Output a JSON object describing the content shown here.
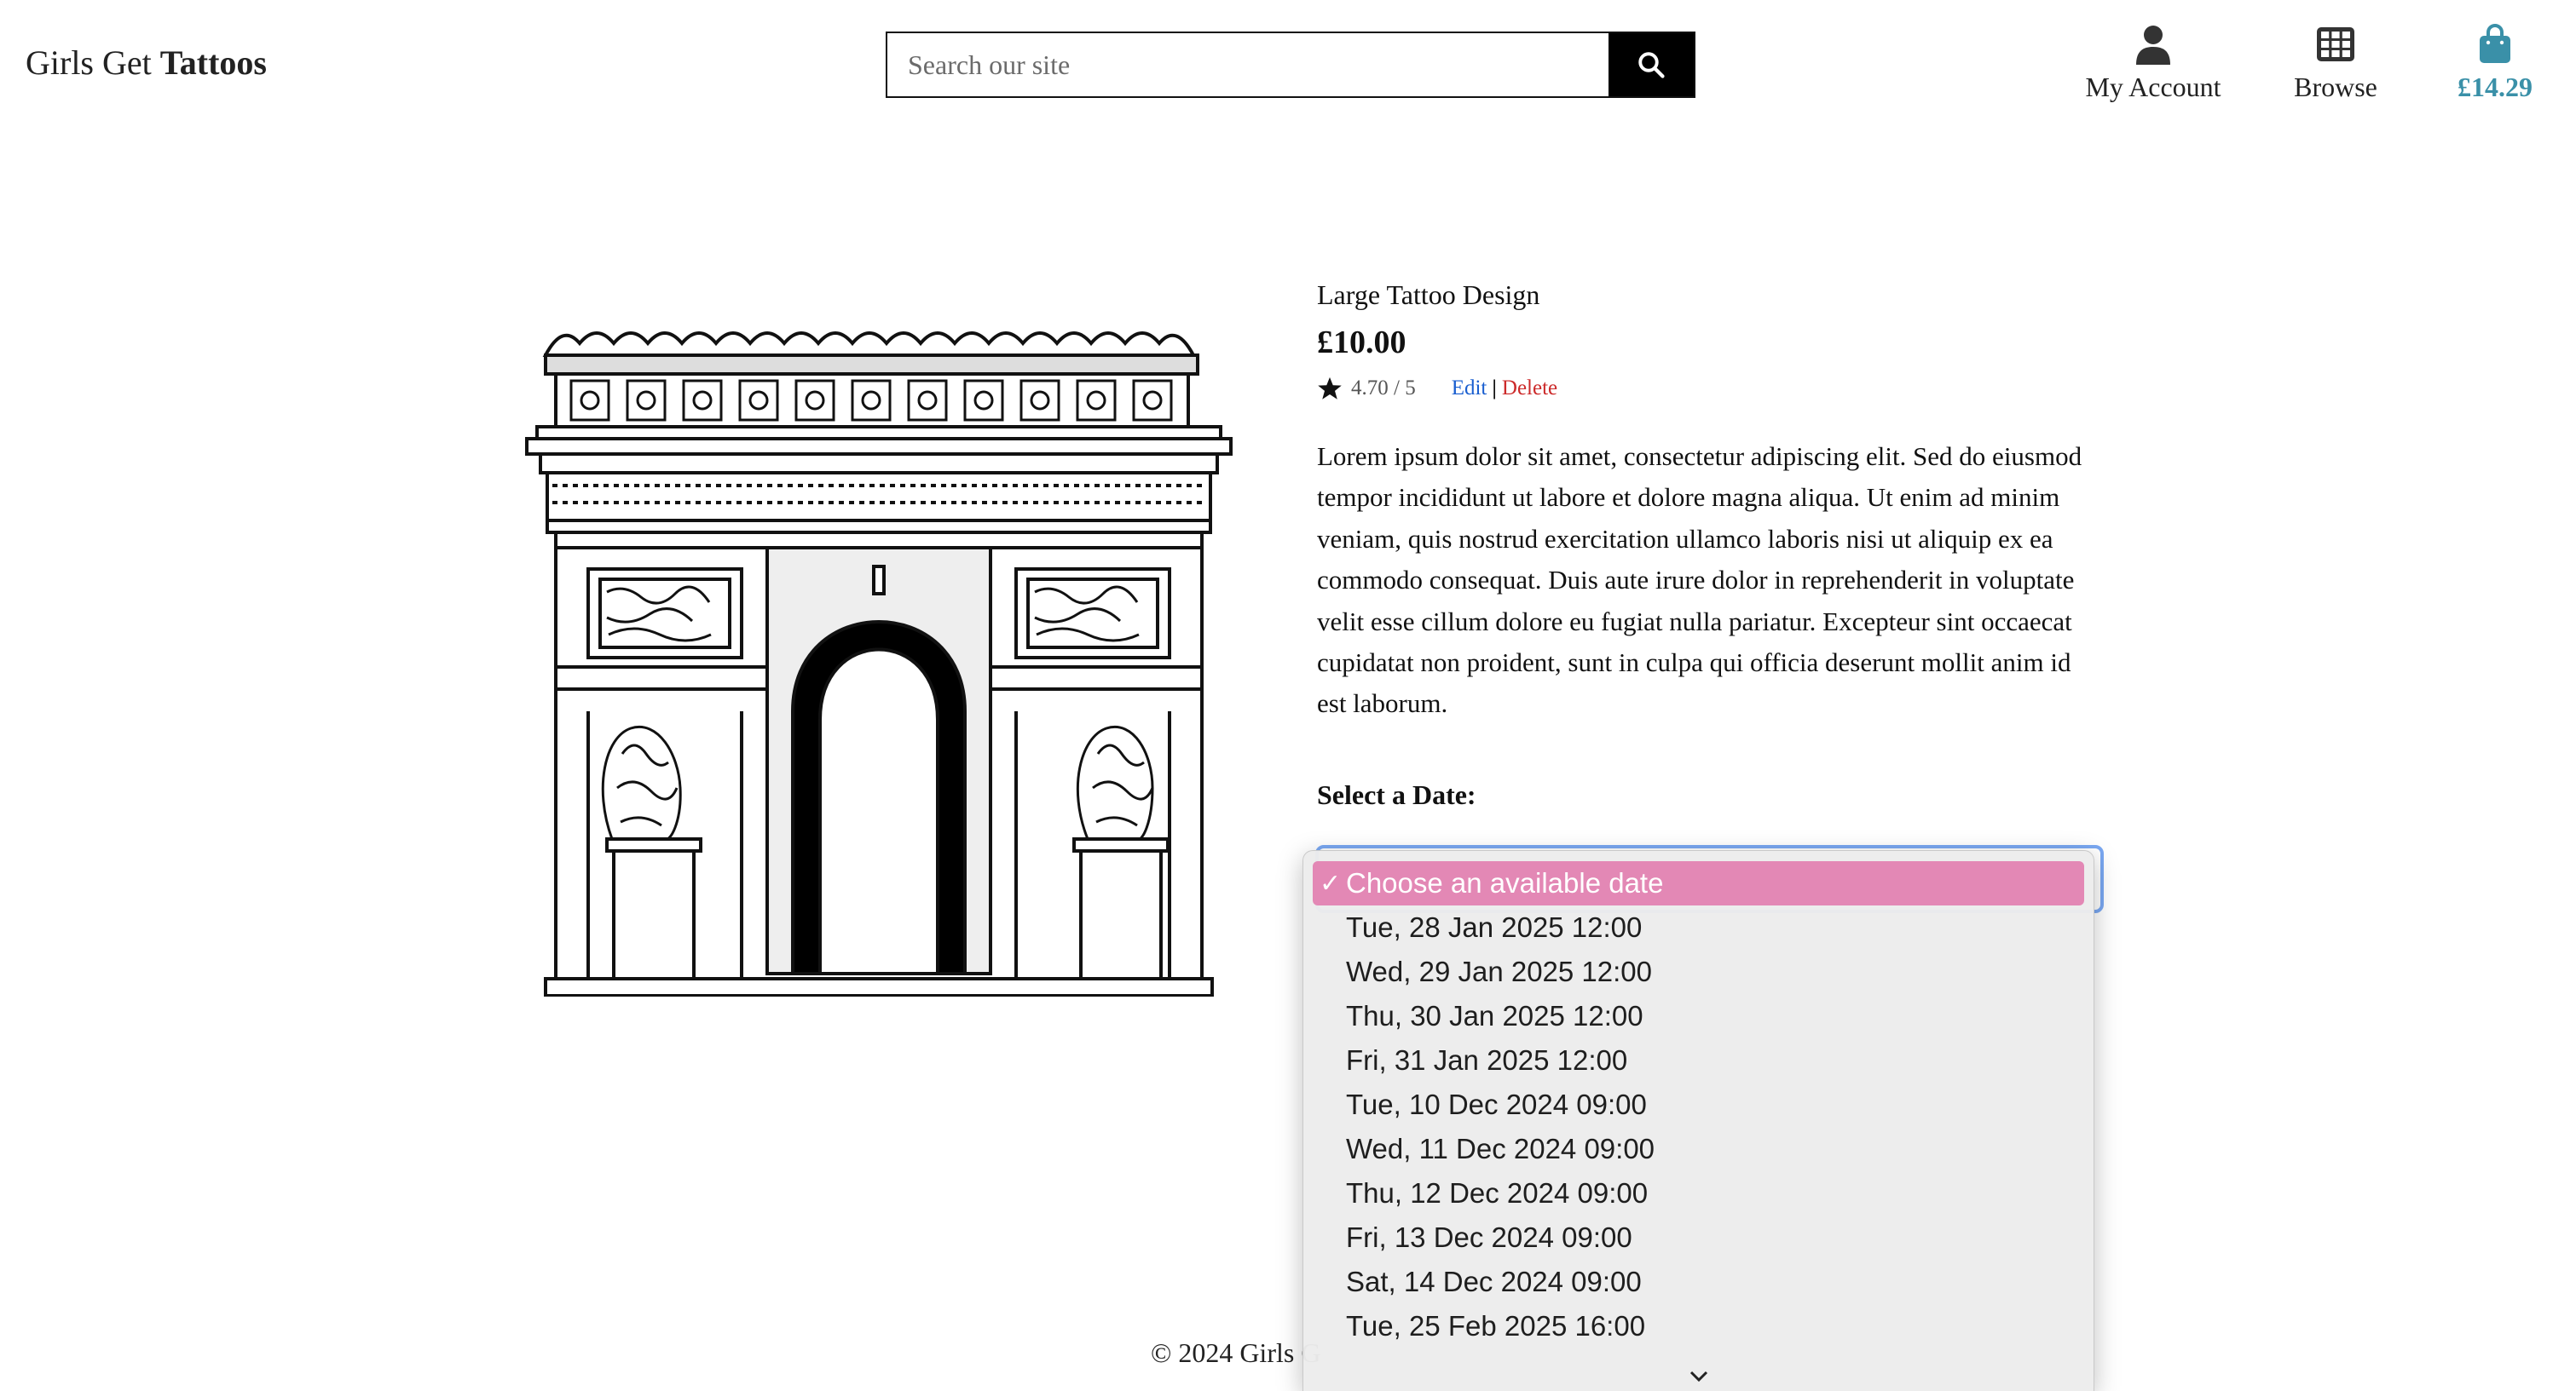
{
  "header": {
    "logo_prefix": "Girls Get",
    "logo_bold": "Tattoos",
    "search_placeholder": "Search our site",
    "account_label": "My Account",
    "browse_label": "Browse",
    "cart_total": "£14.29"
  },
  "product": {
    "title": "Large Tattoo Design",
    "price": "£10.00",
    "rating": "4.70 / 5",
    "edit_label": "Edit",
    "separator": "|",
    "delete_label": "Delete",
    "description": "Lorem ipsum dolor sit amet, consectetur adipiscing elit. Sed do eiusmod tempor incididunt ut labore et dolore magna aliqua. Ut enim ad minim veniam, quis nostrud exercitation ullamco laboris nisi ut aliquip ex ea commodo consequat. Duis aute irure dolor in reprehenderit in voluptate velit esse cillum dolore eu fugiat nulla pariatur. Excepteur sint occaecat cupidatat non proident, sunt in culpa qui officia deserunt mollit anim id est laborum.",
    "select_label": "Select a Date:"
  },
  "date_dropdown": {
    "selected": "Choose an available date",
    "check_mark": "✓",
    "options": [
      "Tue, 28 Jan 2025 12:00",
      "Wed, 29 Jan 2025 12:00",
      "Thu, 30 Jan 2025 12:00",
      "Fri, 31 Jan 2025 12:00",
      "Tue, 10 Dec 2024 09:00",
      "Wed, 11 Dec 2024 09:00",
      "Thu, 12 Dec 2024 09:00",
      "Fri, 13 Dec 2024 09:00",
      "Sat, 14 Dec 2024 09:00",
      "Tue, 25 Feb 2025 16:00"
    ]
  },
  "footer": {
    "text": "© 2024 Girls G"
  },
  "colors": {
    "accent_cart": "#3a90a8",
    "selected_option": "#e388b5",
    "edit_link": "#1a5fd0",
    "delete_link": "#cc2a2a"
  },
  "icons": [
    "search-icon",
    "user-icon",
    "grid-icon",
    "shopping-bag-icon",
    "star-icon",
    "checkmark-icon",
    "chevron-down-icon"
  ]
}
